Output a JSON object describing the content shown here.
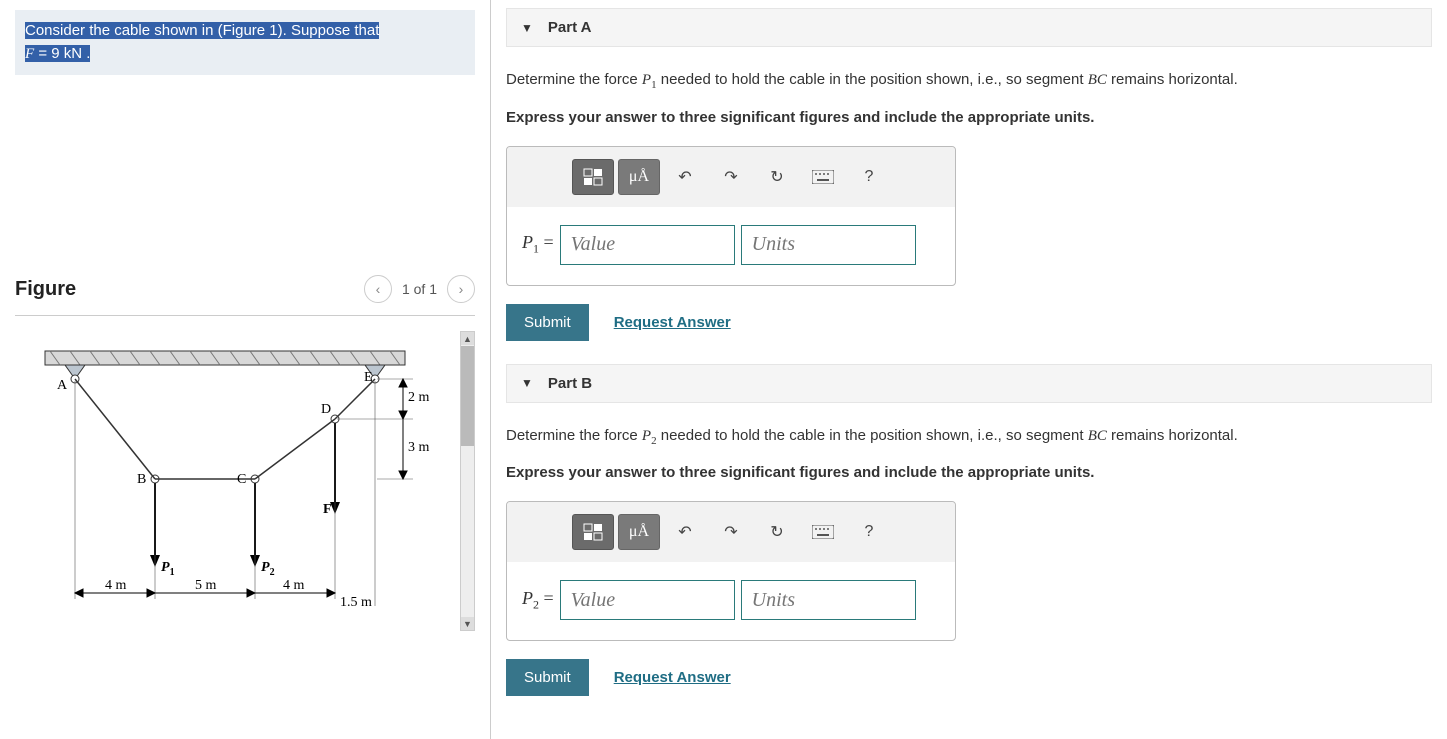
{
  "problem": {
    "line1": "Consider the cable shown in (Figure 1). Suppose that",
    "line2_var": "F",
    "line2_eq": " = 9 ",
    "line2_unit": "kN",
    "line2_end": " ."
  },
  "figure": {
    "title": "Figure",
    "pager": "1 of 1",
    "labels": {
      "A": "A",
      "B": "B",
      "C": "C",
      "D": "D",
      "E": "E",
      "F": "F",
      "P1": "P",
      "P1sub": "1",
      "P2": "P",
      "P2sub": "2",
      "d4m_1": "4 m",
      "d5m": "5 m",
      "d4m_2": "4 m",
      "d15m": "1.5 m",
      "d2m": "2 m",
      "d3m": "3 m"
    }
  },
  "partA": {
    "title": "Part A",
    "question_pre": "Determine the force ",
    "question_var": "P",
    "question_sub": "1",
    "question_post": " needed to hold the cable in the position shown, i.e., so segment ",
    "question_seg": "BC",
    "question_end": " remains horizontal.",
    "instruction": "Express your answer to three significant figures and include the appropriate units.",
    "label_var": "P",
    "label_sub": "1",
    "label_eq": " =",
    "value_placeholder": "Value",
    "units_placeholder": "Units",
    "submit": "Submit",
    "request": "Request Answer",
    "mu_label": "μÅ"
  },
  "partB": {
    "title": "Part B",
    "question_pre": "Determine the force ",
    "question_var": "P",
    "question_sub": "2",
    "question_post": " needed to hold the cable in the position shown, i.e., so segment ",
    "question_seg": "BC",
    "question_end": " remains horizontal.",
    "instruction": "Express your answer to three significant figures and include the appropriate units.",
    "label_var": "P",
    "label_sub": "2",
    "label_eq": " =",
    "value_placeholder": "Value",
    "units_placeholder": "Units",
    "submit": "Submit",
    "request": "Request Answer",
    "mu_label": "μÅ"
  }
}
